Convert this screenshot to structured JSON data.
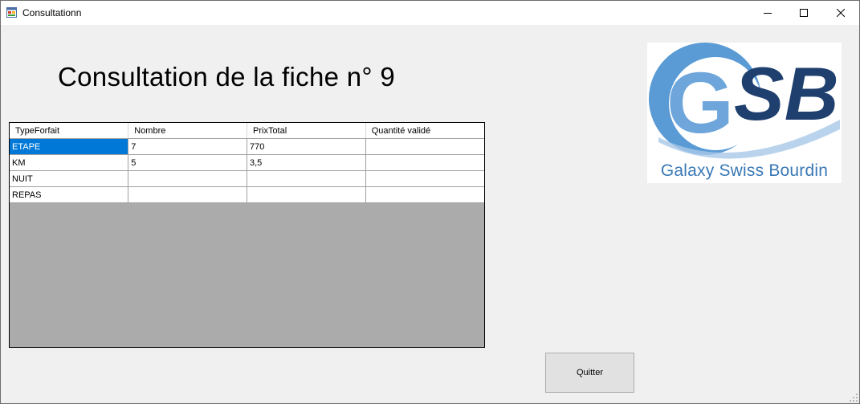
{
  "window": {
    "title": "Consultationn"
  },
  "heading": "Consultation de la fiche n° 9",
  "table": {
    "columns": [
      "TypeForfait",
      "Nombre",
      "PrixTotal",
      "Quantité validé"
    ],
    "rows": [
      [
        "ETAPE",
        "7",
        "770",
        ""
      ],
      [
        "KM",
        "5",
        "3,5",
        ""
      ],
      [
        "NUIT",
        "",
        "",
        ""
      ],
      [
        "REPAS",
        "",
        "",
        ""
      ]
    ],
    "selected_cell": "ETAPE"
  },
  "logo": {
    "letters": "GSB",
    "caption": "Galaxy Swiss Bourdin"
  },
  "buttons": {
    "quit_label": "Quitter"
  },
  "colors": {
    "selection": "#0078d7",
    "grid_background": "#ababab",
    "logo_light_blue": "#5a9bd5",
    "logo_dark_blue": "#1f3f6e"
  }
}
